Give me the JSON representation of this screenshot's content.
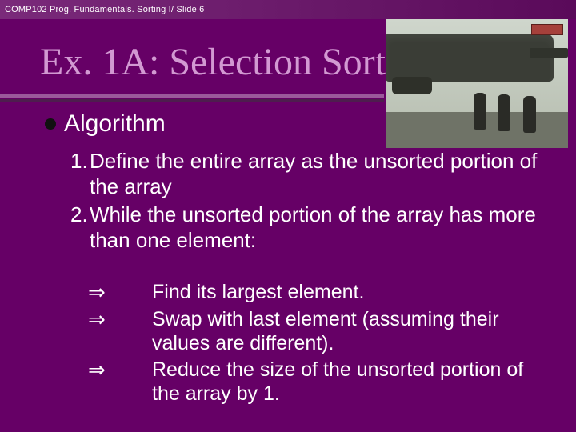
{
  "header": {
    "text": "COMP102 Prog. Fundamentals. Sorting I/ Slide 6"
  },
  "title": "Ex. 1A: Selection Sort",
  "bullet": {
    "label": "Algorithm"
  },
  "steps": [
    {
      "num": "1.",
      "text": "Define the entire array as the unsorted portion of the array"
    },
    {
      "num": "2.",
      "text": "While the unsorted portion of the array has more than one element:"
    }
  ],
  "substeps": [
    {
      "arrow": "⇒",
      "text": "Find its largest element."
    },
    {
      "arrow": "⇒",
      "text": "Swap with last element (assuming their values are different)."
    },
    {
      "arrow": "⇒",
      "text": "Reduce the size of the unsorted portion of the array by 1."
    }
  ],
  "image": {
    "alt": "helicopter-photo"
  }
}
